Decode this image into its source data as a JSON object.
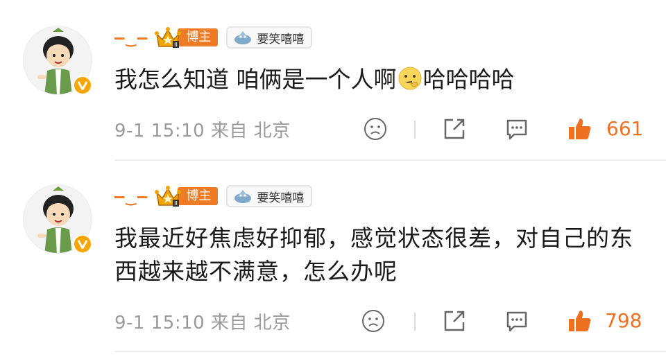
{
  "comments": [
    {
      "username": "–‿–",
      "host_tag": "博主",
      "fan_tag": "要笑嘻嘻",
      "text_part1": "我怎么知道 咱俩是一个人啊",
      "emoji": "thinking-face",
      "text_part2": "哈哈哈哈",
      "time": "9-1 15:10 来自 北京",
      "likes": "661"
    },
    {
      "username": "–‿–",
      "host_tag": "博主",
      "fan_tag": "要笑嘻嘻",
      "text": "我最近好焦虑好抑郁，感觉状态很差，对自己的东西越来越不满意，怎么办呢",
      "time": "9-1 15:10 来自 北京",
      "likes": "798"
    }
  ],
  "colors": {
    "accent": "#ef7021",
    "host_tag_bg": "#ef7b24",
    "meta_gray": "#9a9a9a"
  }
}
